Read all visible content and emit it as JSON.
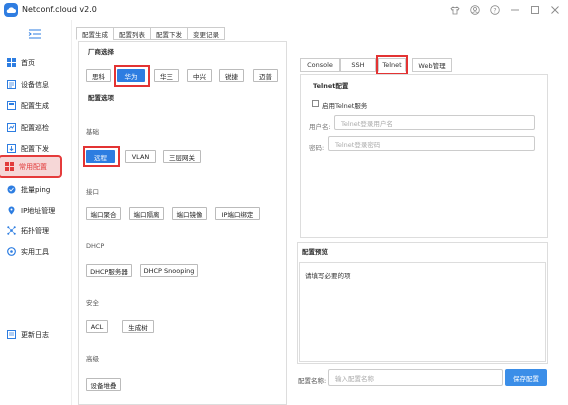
{
  "window": {
    "title": "Netconf.cloud v2.0",
    "controls": [
      "shirt-icon",
      "user-icon",
      "help-icon",
      "minimize-icon",
      "maximize-icon",
      "close-icon"
    ]
  },
  "sidebar": {
    "items": [
      {
        "label": "首页",
        "icon": "grid-icon"
      },
      {
        "label": "设备信息",
        "icon": "device-info-icon"
      },
      {
        "label": "配置生成",
        "icon": "config-gen-icon"
      },
      {
        "label": "配置巡检",
        "icon": "inspect-icon"
      },
      {
        "label": "配置下发",
        "icon": "deploy-icon"
      },
      {
        "label": "常用配置",
        "icon": "common-config-icon",
        "active": true
      },
      {
        "label": "批量ping",
        "icon": "ping-icon"
      },
      {
        "label": "IP地址管理",
        "icon": "ip-icon"
      },
      {
        "label": "拓扑管理",
        "icon": "topology-icon"
      },
      {
        "label": "实用工具",
        "icon": "tools-icon"
      },
      {
        "label": "更新日志",
        "icon": "changelog-icon"
      }
    ]
  },
  "top_tabs": [
    "配置生成",
    "配置列表",
    "配置下发",
    "变更记录"
  ],
  "vendor": {
    "title": "厂商选择",
    "options": [
      "思科",
      "华为",
      "华三",
      "中兴",
      "锐捷",
      "迈普"
    ],
    "selected": "华为"
  },
  "config_options": {
    "title": "配置选项",
    "groups": [
      {
        "label": "基础",
        "buttons": [
          "远程",
          "VLAN",
          "三层网关"
        ],
        "selected": "远程"
      },
      {
        "label": "接口",
        "buttons": [
          "端口聚合",
          "端口隔离",
          "端口镜像",
          "IP端口绑定"
        ]
      },
      {
        "label": "DHCP",
        "buttons": [
          "DHCP服务器",
          "DHCP Snooping"
        ]
      },
      {
        "label": "安全",
        "buttons": [
          "ACL",
          "生成树"
        ]
      },
      {
        "label": "高级",
        "buttons": [
          "设备堆叠"
        ]
      }
    ]
  },
  "protocol_tabs": [
    "Console",
    "SSH",
    "Telnet",
    "Web管理"
  ],
  "protocol_selected": "Telnet",
  "telnet": {
    "title": "Telnet配置",
    "enable_label": "启用Telnet服务",
    "enabled": false,
    "username_label": "用户名:",
    "username_placeholder": "Telnet登录用户名",
    "password_label": "密码:",
    "password_placeholder": "Telnet登录密码"
  },
  "preview": {
    "title": "配置预览",
    "text": "请填写必要的项"
  },
  "footer": {
    "name_label": "配置名称:",
    "name_placeholder": "输入配置名称",
    "save_label": "保存配置"
  },
  "colors": {
    "accent": "#2d7de1",
    "highlight": "#e33333",
    "active_nav_bg": "#f6d7d7"
  }
}
